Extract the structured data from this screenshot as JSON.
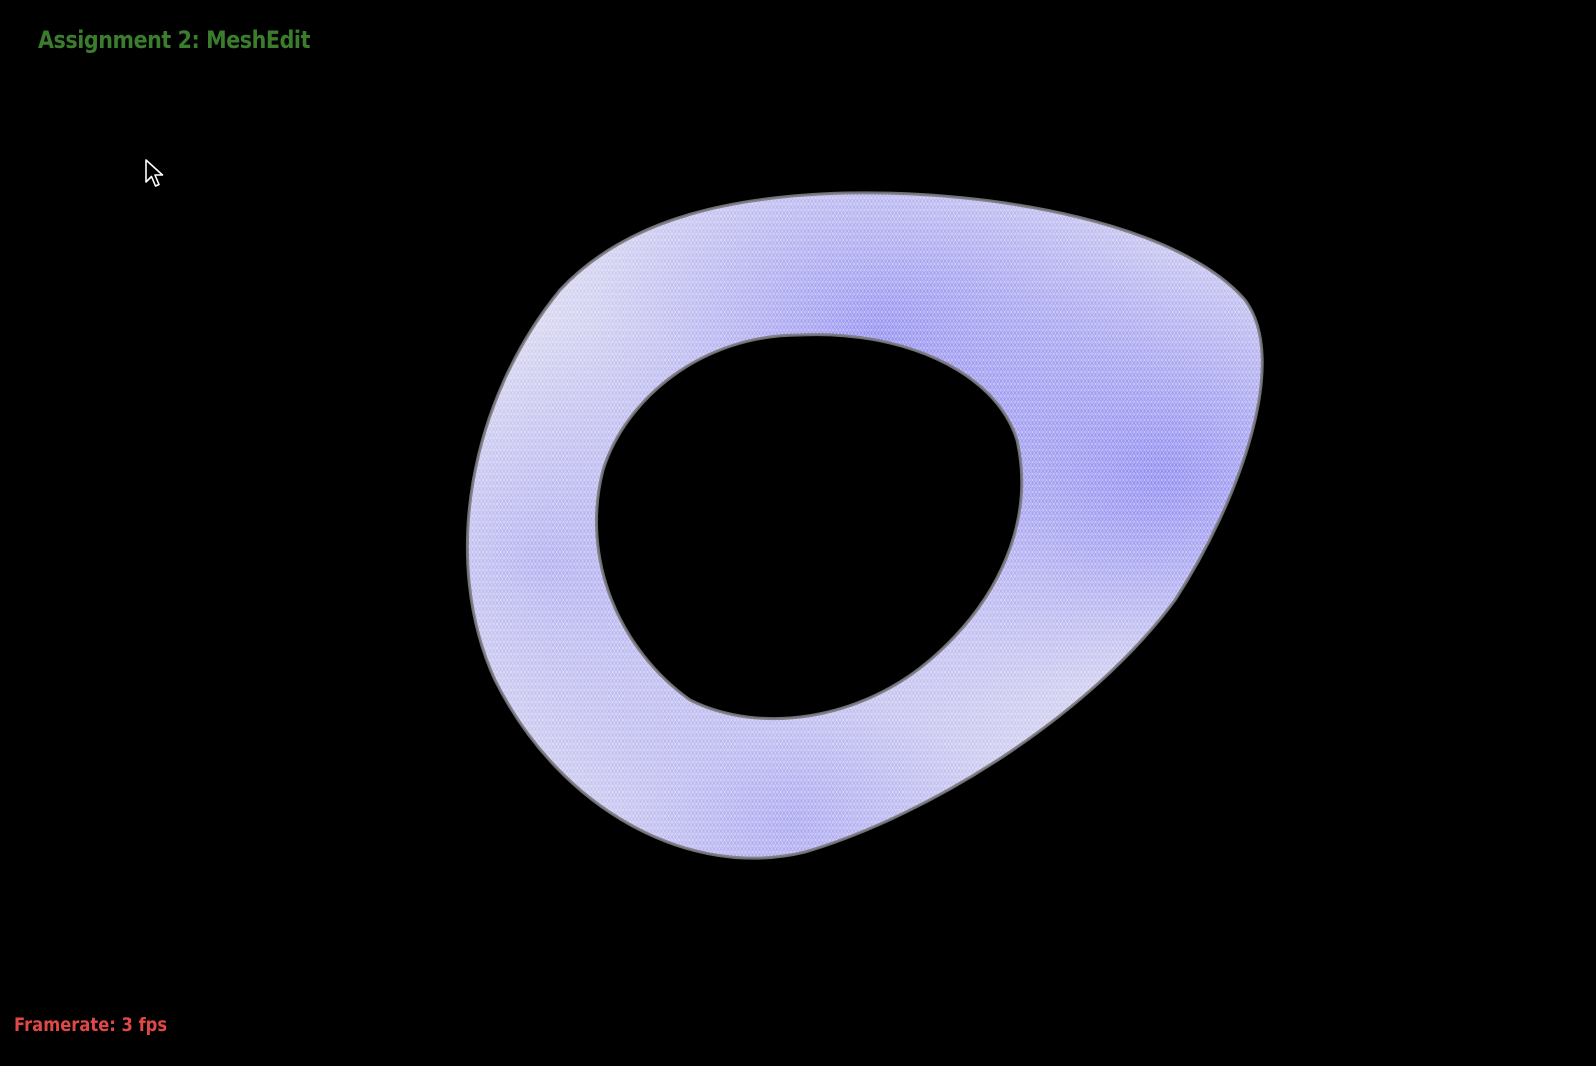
{
  "app": {
    "title": "Assignment 2: MeshEdit",
    "title_color": "#3a7d2c"
  },
  "status": {
    "framerate_label": "Framerate: 3 fps",
    "framerate_color": "#e04848"
  },
  "viewport": {
    "background_color": "#000000",
    "model": "torus-mesh",
    "mesh_colors": {
      "light": "#e8e8ef",
      "highlight": "#8a85f2",
      "wire": "#ffffff",
      "rim": "#7a7a80"
    },
    "cursor_icon": "mouse-pointer-icon"
  }
}
